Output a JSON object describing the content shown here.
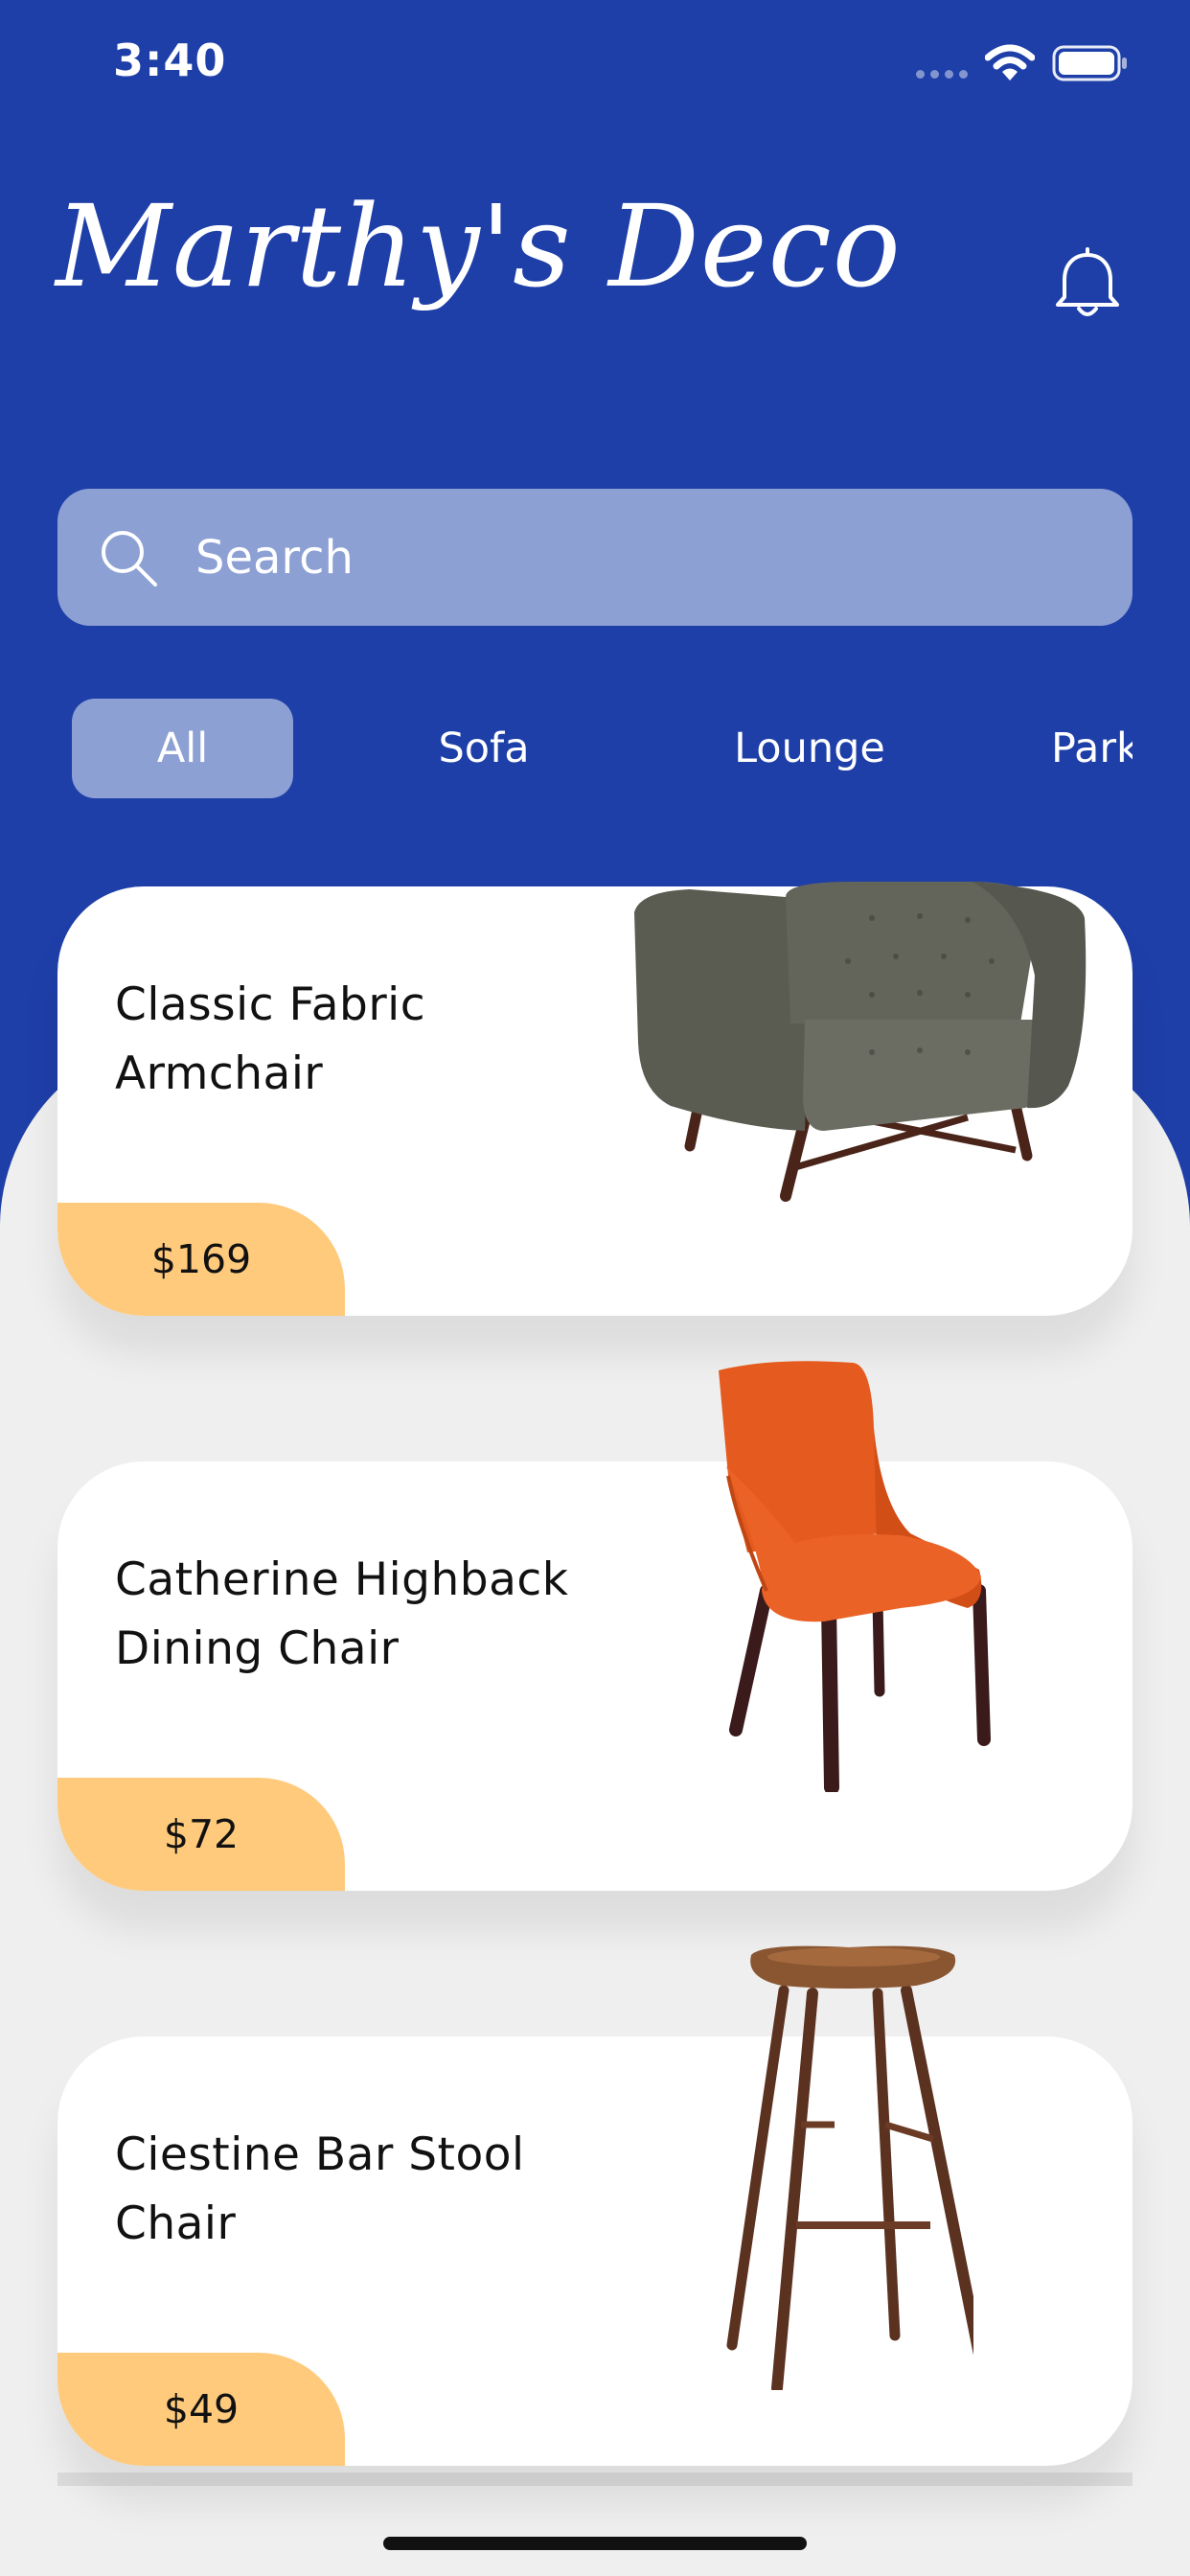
{
  "status_bar": {
    "time": "3:40"
  },
  "app": {
    "title": "Marthy's Deco"
  },
  "search": {
    "placeholder": "Search"
  },
  "filters": [
    {
      "label": "All",
      "active": true
    },
    {
      "label": "Sofa",
      "active": false
    },
    {
      "label": "Lounge",
      "active": false
    },
    {
      "label": "Park",
      "active": false
    }
  ],
  "products": [
    {
      "name": "Classic Fabric Armchair",
      "price": "$169",
      "image": "grey-armchair"
    },
    {
      "name": "Catherine Highback Dining Chair",
      "price": "$72",
      "image": "orange-dining-chair"
    },
    {
      "name": "Ciestine Bar Stool Chair",
      "price": "$49",
      "image": "wooden-bar-stool"
    }
  ],
  "colors": {
    "primary": "#1e3fa8",
    "search_bg": "#8da0d4",
    "price_badge": "#ffca7c",
    "content_bg": "#efefef",
    "card_bg": "#ffffff"
  }
}
